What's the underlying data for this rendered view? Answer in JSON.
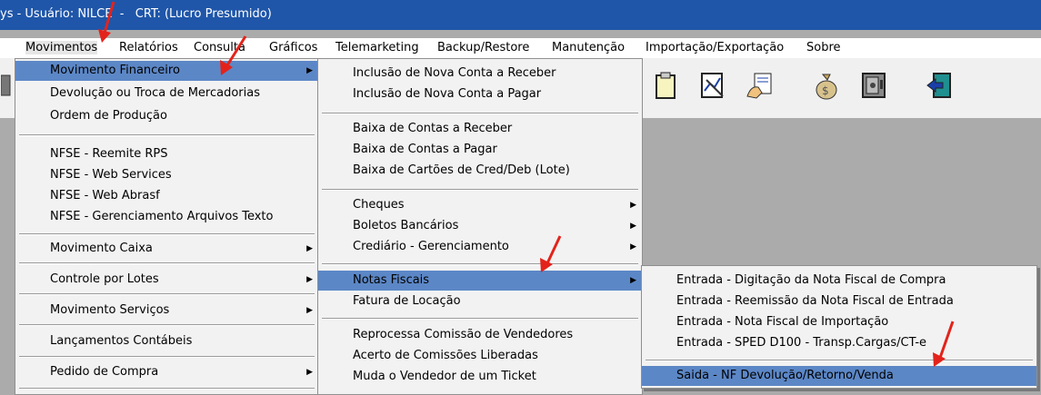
{
  "titlebar": {
    "text": "ys - Usuário: NILCE  -   CRT: (Lucro Presumido)"
  },
  "menubar": {
    "items": [
      "Movimentos",
      "Relatórios",
      "Consulta",
      "Gráficos",
      "Telemarketing",
      "Backup/Restore",
      "Manutenção",
      "Importação/Exportação",
      "Sobre"
    ]
  },
  "menu_movimentos": {
    "items": [
      "Movimento Financeiro",
      "Devolução ou Troca de Mercadorias",
      "Ordem de Produção",
      "NFSE - Reemite RPS",
      "NFSE - Web Services",
      "NFSE - Web Abrasf",
      "NFSE - Gerenciamento Arquivos Texto",
      "Movimento Caixa",
      "Controle por Lotes",
      "Movimento Serviços",
      "Lançamentos Contábeis",
      "Pedido de Compra"
    ]
  },
  "menu_financeiro": {
    "items": [
      "Inclusão de Nova Conta a Receber",
      "Inclusão de Nova Conta a Pagar",
      "Baixa de Contas a Receber",
      "Baixa de Contas a Pagar",
      "Baixa de Cartões de Cred/Deb (Lote)",
      "Cheques",
      "Boletos Bancários",
      "Crediário - Gerenciamento",
      "Notas Fiscais",
      "Fatura de Locação",
      "Reprocessa Comissão de Vendedores",
      "Acerto de Comissões Liberadas",
      "Muda o Vendedor de um Ticket"
    ]
  },
  "menu_notas": {
    "items": [
      "Entrada - Digitação da Nota Fiscal de Compra",
      "Entrada - Reemissão da Nota Fiscal de Entrada",
      "Entrada - Nota Fiscal de Importação",
      "Entrada - SPED D100 - Transp.Cargas/CT-e",
      "Saida - NF Devolução/Retorno/Venda"
    ]
  },
  "toolbar": {
    "icons": [
      "clipboard-icon",
      "chart-edit-icon",
      "hand-document-icon",
      "money-bag-icon",
      "safe-icon",
      "exit-door-icon"
    ]
  },
  "colors": {
    "highlight": "#5c87c6",
    "titlebar": "#1f56a9",
    "arrow": "#e3231b"
  }
}
